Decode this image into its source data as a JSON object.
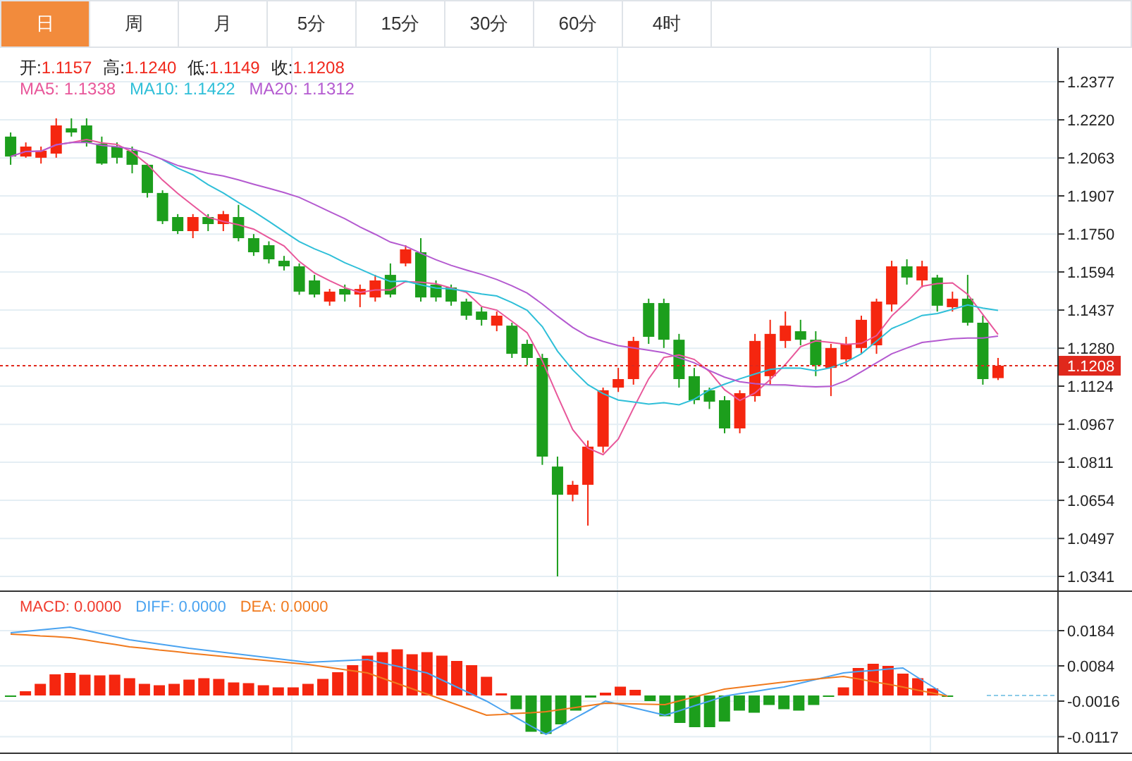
{
  "tabs": [
    {
      "label": "日",
      "selected": true
    },
    {
      "label": "周",
      "selected": false
    },
    {
      "label": "月",
      "selected": false
    },
    {
      "label": "5分",
      "selected": false
    },
    {
      "label": "15分",
      "selected": false
    },
    {
      "label": "30分",
      "selected": false
    },
    {
      "label": "60分",
      "selected": false
    },
    {
      "label": "4时",
      "selected": false
    }
  ],
  "price_panel": {
    "ohlc_legend": [
      {
        "label": "开:",
        "value": "1.1157"
      },
      {
        "label": "高:",
        "value": "1.1240"
      },
      {
        "label": "低:",
        "value": "1.1149"
      },
      {
        "label": "收:",
        "value": "1.1208"
      }
    ],
    "ma_legend": [
      {
        "text": "MA5: 1.1338",
        "color": "#e8579a"
      },
      {
        "text": "MA10: 1.1422",
        "color": "#2fbfd8"
      },
      {
        "text": "MA20: 1.1312",
        "color": "#b45ad0"
      }
    ],
    "chart_data": {
      "type": "candlestick",
      "grid": true,
      "ylim": [
        1.0283,
        1.2516
      ],
      "ref_lines": [
        {
          "axis": "y",
          "value": 1.1208,
          "label": "1.1208",
          "color": "#e0281c"
        }
      ],
      "categories": [
        null,
        null,
        null,
        null,
        null,
        null,
        null,
        null,
        null,
        null,
        null,
        null,
        null,
        null,
        null,
        null,
        null,
        null,
        null,
        null,
        null,
        null,
        null,
        null,
        null,
        null,
        null,
        null,
        null,
        null,
        null,
        null,
        null,
        null,
        null,
        null,
        null,
        null,
        null,
        null,
        null,
        null,
        null,
        null,
        null,
        null,
        null,
        null,
        null,
        null,
        null,
        null,
        null,
        null,
        null,
        null,
        null,
        null,
        null,
        null,
        null,
        null,
        null,
        null,
        null,
        null
      ],
      "yticks": [
        {
          "value": 1.2377,
          "label": "1.2377"
        },
        {
          "value": 1.222,
          "label": "1.2220"
        },
        {
          "value": 1.2063,
          "label": "1.2063"
        },
        {
          "value": 1.1907,
          "label": "1.1907"
        },
        {
          "value": 1.175,
          "label": "1.1750"
        },
        {
          "value": 1.1594,
          "label": "1.1594"
        },
        {
          "value": 1.1437,
          "label": "1.1437"
        },
        {
          "value": 1.128,
          "label": "1.1280"
        },
        {
          "value": 1.1124,
          "label": "1.1124"
        },
        {
          "value": 1.0967,
          "label": "1.0967"
        },
        {
          "value": 1.0811,
          "label": "1.0811"
        },
        {
          "value": 1.0654,
          "label": "1.0654"
        },
        {
          "value": 1.0497,
          "label": "1.0497"
        },
        {
          "value": 1.0341,
          "label": "1.0341"
        }
      ],
      "ohlc": [
        [
          1.2151,
          1.2168,
          1.2035,
          1.2069
        ],
        [
          1.2069,
          1.2127,
          1.2064,
          1.211
        ],
        [
          1.2064,
          1.211,
          1.204,
          1.2093
        ],
        [
          1.2081,
          1.2226,
          1.2064,
          1.2197
        ],
        [
          1.2185,
          1.2226,
          1.2151,
          1.2168
        ],
        [
          1.2197,
          1.2226,
          1.211,
          1.2127
        ],
        [
          1.2122,
          1.2151,
          1.2035,
          1.204
        ],
        [
          1.211,
          1.2127,
          1.204,
          1.2064
        ],
        [
          1.2093,
          1.211,
          1.2,
          1.2035
        ],
        [
          1.2035,
          1.204,
          1.19,
          1.1919
        ],
        [
          1.1919,
          1.193,
          1.1791,
          1.1803
        ],
        [
          1.182,
          1.1832,
          1.175,
          1.1762
        ],
        [
          1.1762,
          1.1832,
          1.1733,
          1.182
        ],
        [
          1.182,
          1.1832,
          1.1762,
          1.1791
        ],
        [
          1.1791,
          1.1845,
          1.1762,
          1.1832
        ],
        [
          1.182,
          1.187,
          1.172,
          1.1733
        ],
        [
          1.1733,
          1.175,
          1.166,
          1.1675
        ],
        [
          1.1704,
          1.172,
          1.1629,
          1.1646
        ],
        [
          1.164,
          1.166,
          1.16,
          1.1617
        ],
        [
          1.1617,
          1.1629,
          1.15,
          1.1513
        ],
        [
          1.1559,
          1.1582,
          1.1489,
          1.1501
        ],
        [
          1.1472,
          1.1524,
          1.1455,
          1.1513
        ],
        [
          1.1524,
          1.1542,
          1.1472,
          1.1501
        ],
        [
          1.1501,
          1.1542,
          1.1449,
          1.1524
        ],
        [
          1.1489,
          1.1582,
          1.1472,
          1.1559
        ],
        [
          1.1582,
          1.1629,
          1.1489,
          1.1501
        ],
        [
          1.1629,
          1.1704,
          1.1617,
          1.1687
        ],
        [
          1.1675,
          1.1733,
          1.1472,
          1.1489
        ],
        [
          1.1542,
          1.1559,
          1.1472,
          1.1489
        ],
        [
          1.153,
          1.1542,
          1.1455,
          1.1472
        ],
        [
          1.1472,
          1.1484,
          1.1397,
          1.1414
        ],
        [
          1.1431,
          1.1449,
          1.1373,
          1.1397
        ],
        [
          1.1373,
          1.1431,
          1.135,
          1.1414
        ],
        [
          1.1373,
          1.1385,
          1.124,
          1.1257
        ],
        [
          1.1298,
          1.1315,
          1.1211,
          1.124
        ],
        [
          1.124,
          1.1257,
          1.08,
          1.0834
        ],
        [
          1.0793,
          1.0834,
          1.0341,
          1.0677
        ],
        [
          1.0677,
          1.0734,
          1.065,
          1.0718
        ],
        [
          1.0718,
          1.09,
          1.055,
          1.0875
        ],
        [
          1.0875,
          1.1118,
          1.085,
          1.1107
        ],
        [
          1.1118,
          1.1199,
          1.11,
          1.1153
        ],
        [
          1.1153,
          1.1327,
          1.113,
          1.131
        ],
        [
          1.1466,
          1.1484,
          1.1298,
          1.1327
        ],
        [
          1.1466,
          1.1484,
          1.1281,
          1.1315
        ],
        [
          1.1315,
          1.1339,
          1.1118,
          1.1153
        ],
        [
          1.1165,
          1.1199,
          1.105,
          1.1066
        ],
        [
          1.1107,
          1.1118,
          1.103,
          1.106
        ],
        [
          1.1066,
          1.1083,
          1.093,
          1.095
        ],
        [
          1.095,
          1.1107,
          1.093,
          1.1095
        ],
        [
          1.1083,
          1.1339,
          1.106,
          1.131
        ],
        [
          1.1165,
          1.1397,
          1.113,
          1.1339
        ],
        [
          1.131,
          1.1431,
          1.1281,
          1.1373
        ],
        [
          1.135,
          1.1397,
          1.1292,
          1.1315
        ],
        [
          1.1315,
          1.135,
          1.1165,
          1.1211
        ],
        [
          1.1199,
          1.1298,
          1.1083,
          1.1281
        ],
        [
          1.1234,
          1.1327,
          1.1211,
          1.1298
        ],
        [
          1.1281,
          1.1414,
          1.1257,
          1.1397
        ],
        [
          1.1292,
          1.1484,
          1.1257,
          1.1472
        ],
        [
          1.146,
          1.164,
          1.1431,
          1.1617
        ],
        [
          1.1617,
          1.1646,
          1.1542,
          1.1571
        ],
        [
          1.1559,
          1.164,
          1.153,
          1.1617
        ],
        [
          1.1571,
          1.1582,
          1.1431,
          1.1455
        ],
        [
          1.1449,
          1.1513,
          1.1431,
          1.1484
        ],
        [
          1.1484,
          1.1582,
          1.1373,
          1.1385
        ],
        [
          1.1385,
          1.1414,
          1.113,
          1.1153
        ],
        [
          1.1157,
          1.124,
          1.1149,
          1.1208
        ]
      ],
      "series": [
        {
          "type": "line",
          "color": "#e8579a",
          "values": [
            1.2069,
            1.209,
            1.2091,
            1.2117,
            1.2127,
            1.2139,
            1.2125,
            1.2119,
            1.2087,
            1.2037,
            1.1972,
            1.1917,
            1.1868,
            1.1819,
            1.1802,
            1.1788,
            1.177,
            1.1735,
            1.1701,
            1.1637,
            1.159,
            1.1558,
            1.1529,
            1.151,
            1.152,
            1.152,
            1.1554,
            1.1552,
            1.1545,
            1.1528,
            1.151,
            1.1452,
            1.1437,
            1.1391,
            1.1344,
            1.1228,
            1.1084,
            1.0945,
            1.0869,
            1.0842,
            1.0906,
            1.1033,
            1.1154,
            1.1242,
            1.1252,
            1.1234,
            1.1184,
            1.1109,
            1.1065,
            1.1096,
            1.1151,
            1.1213,
            1.1286,
            1.131,
            1.1304,
            1.1296,
            1.13,
            1.1332,
            1.1413,
            1.1471,
            1.1535,
            1.1546,
            1.1549,
            1.1502,
            1.1419,
            1.1337
          ]
        },
        {
          "type": "line",
          "color": "#2fbfd8",
          "values": [
            null,
            null,
            null,
            null,
            null,
            null,
            null,
            null,
            null,
            null,
            1.2056,
            1.2021,
            1.1994,
            1.1953,
            1.1919,
            1.188,
            1.1843,
            1.1802,
            1.176,
            1.1719,
            1.1689,
            1.1664,
            1.1632,
            1.1606,
            1.1578,
            1.1555,
            1.1556,
            1.1541,
            1.1528,
            1.1524,
            1.1515,
            1.1503,
            1.1495,
            1.1468,
            1.1436,
            1.1369,
            1.1268,
            1.1191,
            1.113,
            1.1093,
            1.1067,
            1.1059,
            1.105,
            1.1056,
            1.1047,
            1.107,
            1.1108,
            1.1132,
            1.1154,
            1.1174,
            1.1193,
            1.1199,
            1.1198,
            1.1187,
            1.12,
            1.1223,
            1.1257,
            1.1309,
            1.1361,
            1.1387,
            1.1415,
            1.1423,
            1.144,
            1.1458,
            1.1445,
            1.1436
          ]
        },
        {
          "type": "line",
          "color": "#b45ad0",
          "values": [
            1.2069,
            1.209,
            1.2091,
            1.2117,
            1.2127,
            1.2127,
            1.2115,
            1.2109,
            1.21,
            1.2082,
            1.2057,
            1.2032,
            1.2016,
            1.2,
            1.1989,
            1.1973,
            1.1955,
            1.1938,
            1.1921,
            1.1901,
            1.1872,
            1.1842,
            1.1813,
            1.1779,
            1.1749,
            1.1717,
            1.17,
            1.1671,
            1.1644,
            1.1621,
            1.1602,
            1.1584,
            1.1563,
            1.1537,
            1.1507,
            1.1462,
            1.1412,
            1.1366,
            1.1329,
            1.1308,
            1.1291,
            1.1281,
            1.1272,
            1.1262,
            1.1241,
            1.122,
            1.1188,
            1.1161,
            1.1142,
            1.1134,
            1.113,
            1.1129,
            1.1124,
            1.1121,
            1.1123,
            1.1147,
            1.1183,
            1.122,
            1.1257,
            1.1281,
            1.1304,
            1.1311,
            1.1319,
            1.1322,
            1.1322,
            1.133
          ]
        }
      ]
    }
  },
  "macd_panel": {
    "legend": [
      {
        "text": "MACD: 0.0000",
        "color": "#f03c2e"
      },
      {
        "text": "DIFF: 0.0000",
        "color": "#4aa3f0"
      },
      {
        "text": "DEA: 0.0000",
        "color": "#f07a1e"
      }
    ],
    "chart_data": {
      "type": "bar",
      "grid": true,
      "ylim": [
        -0.0162,
        0.0294
      ],
      "categories": [
        null,
        null,
        null,
        null,
        null,
        null,
        null,
        null,
        null,
        null,
        null,
        null,
        null,
        null,
        null,
        null,
        null,
        null,
        null,
        null,
        null,
        null,
        null,
        null,
        null,
        null,
        null,
        null,
        null,
        null,
        null,
        null,
        null,
        null,
        null,
        null,
        null,
        null,
        null,
        null,
        null,
        null,
        null,
        null,
        null,
        null,
        null,
        null,
        null,
        null,
        null,
        null,
        null,
        null,
        null,
        null,
        null,
        null,
        null,
        null,
        null,
        null,
        null,
        null
      ],
      "yticks": [
        {
          "value": 0.0184,
          "label": "0.0184"
        },
        {
          "value": 0.0084,
          "label": "0.0084"
        },
        {
          "value": -0.0016,
          "label": "-0.0016"
        },
        {
          "value": -0.0117,
          "label": "-0.0117"
        }
      ],
      "series": [
        {
          "type": "bar",
          "colors": [
            "#1c9e1c",
            "#f5260f",
            "#f5260f",
            "#f5260f",
            "#f5260f",
            "#f5260f",
            "#f5260f",
            "#f5260f",
            "#f5260f",
            "#f5260f",
            "#f5260f",
            "#f5260f",
            "#f5260f",
            "#f5260f",
            "#f5260f",
            "#f5260f",
            "#f5260f",
            "#f5260f",
            "#f5260f",
            "#f5260f",
            "#f5260f",
            "#f5260f",
            "#f5260f",
            "#f5260f",
            "#f5260f",
            "#f5260f",
            "#f5260f",
            "#f5260f",
            "#f5260f",
            "#f5260f",
            "#f5260f",
            "#f5260f",
            "#f5260f",
            "#f5260f",
            "#1c9e1c",
            "#1c9e1c",
            "#1c9e1c",
            "#1c9e1c",
            "#1c9e1c",
            "#1c9e1c",
            "#f5260f",
            "#f5260f",
            "#f5260f",
            "#1c9e1c",
            "#1c9e1c",
            "#1c9e1c",
            "#1c9e1c",
            "#1c9e1c",
            "#1c9e1c",
            "#1c9e1c",
            "#1c9e1c",
            "#1c9e1c",
            "#1c9e1c",
            "#1c9e1c",
            "#1c9e1c",
            "#1c9e1c",
            "#f5260f",
            "#f5260f",
            "#f5260f",
            "#f5260f",
            "#f5260f",
            "#f5260f",
            "#f5260f",
            "#1c9e1c"
          ],
          "values": [
            -0.0001,
            0.0012,
            0.0033,
            0.006,
            0.0064,
            0.0059,
            0.0057,
            0.0059,
            0.0049,
            0.0033,
            0.0029,
            0.0033,
            0.0045,
            0.0049,
            0.0047,
            0.0037,
            0.0035,
            0.0029,
            0.0023,
            0.0023,
            0.0033,
            0.0047,
            0.0066,
            0.0086,
            0.0113,
            0.0123,
            0.0131,
            0.0117,
            0.0123,
            0.0113,
            0.0098,
            0.0086,
            0.0053,
            0.0006,
            -0.0039,
            -0.0103,
            -0.0109,
            -0.0082,
            -0.0043,
            -0.0006,
            0.0008,
            0.0025,
            0.0016,
            -0.0016,
            -0.0059,
            -0.0078,
            -0.009,
            -0.009,
            -0.0074,
            -0.0043,
            -0.0049,
            -0.0027,
            -0.0039,
            -0.0043,
            -0.0027,
            -0.0002,
            0.0023,
            0.0078,
            0.009,
            0.0084,
            0.0062,
            0.0049,
            0.002,
            -0.0004
          ]
        },
        {
          "type": "line",
          "color": "#4aa3f0",
          "values": [
            0.0178,
            0.0182,
            0.0186,
            0.019,
            0.0194,
            0.0185,
            0.0176,
            0.0167,
            0.0158,
            0.0152,
            0.0146,
            0.014,
            0.0134,
            0.0129,
            0.0124,
            0.0119,
            0.0114,
            0.0109,
            0.0104,
            0.0099,
            0.0094,
            0.0096,
            0.0098,
            0.01,
            0.0102,
            0.0092,
            0.0083,
            0.0073,
            0.0064,
            0.0044,
            0.0024,
            0.0004,
            -0.0016,
            -0.004,
            -0.0063,
            -0.0087,
            -0.011,
            -0.0087,
            -0.0063,
            -0.004,
            -0.0016,
            -0.0026,
            -0.0036,
            -0.0046,
            -0.0056,
            -0.0043,
            -0.0029,
            -0.0016,
            -0.0002,
            0.0005,
            0.0011,
            0.0018,
            0.0024,
            0.0034,
            0.0044,
            0.0054,
            0.0064,
            0.0068,
            0.0071,
            0.0075,
            0.0078,
            0.0051,
            0.0025,
            -0.0002
          ]
        },
        {
          "type": "line",
          "color": "#f07a1e",
          "values": [
            0.0174,
            0.0172,
            0.0169,
            0.0167,
            0.0164,
            0.0158,
            0.0151,
            0.0145,
            0.0138,
            0.0134,
            0.0129,
            0.0125,
            0.012,
            0.0116,
            0.0112,
            0.0108,
            0.0104,
            0.01,
            0.0096,
            0.0092,
            0.0088,
            0.0082,
            0.0076,
            0.007,
            0.0064,
            0.0049,
            0.0034,
            0.0019,
            0.0004,
            -0.0011,
            -0.0026,
            -0.0041,
            -0.0056,
            -0.0054,
            -0.0051,
            -0.0049,
            -0.0046,
            -0.004,
            -0.0034,
            -0.0028,
            -0.0022,
            -0.0023,
            -0.0024,
            -0.0025,
            -0.0026,
            -0.0015,
            -0.0004,
            0.0007,
            0.0018,
            0.0023,
            0.0028,
            0.0033,
            0.0038,
            0.0042,
            0.0046,
            0.005,
            0.0054,
            0.0047,
            0.0039,
            0.0032,
            0.0024,
            0.0015,
            0.0007,
            -0.0002
          ]
        }
      ]
    }
  }
}
